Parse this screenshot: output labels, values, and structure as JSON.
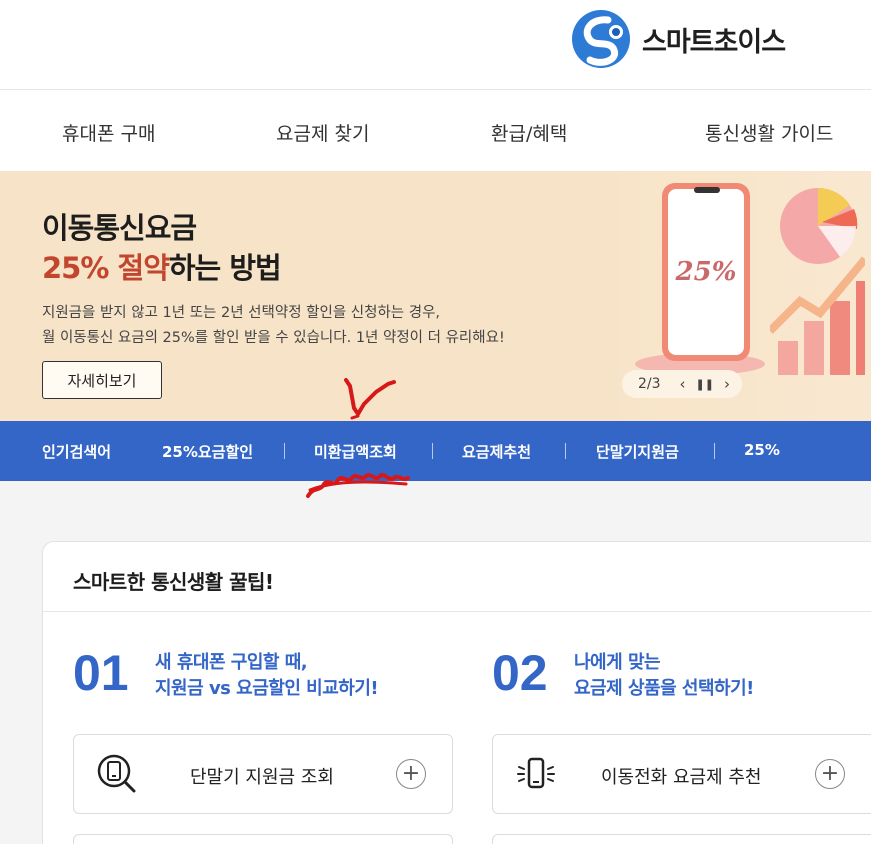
{
  "brand": {
    "name": "스마트초이스",
    "logo_colors": [
      "#2e7bd6",
      "#1a5fb8"
    ]
  },
  "gnb": {
    "items": [
      {
        "label": "휴대폰 구매"
      },
      {
        "label": "요금제 찾기"
      },
      {
        "label": "환급/혜택"
      },
      {
        "label": "통신생활 가이드"
      }
    ]
  },
  "banner": {
    "title_line1": "이동통신요금",
    "title_highlight": "25% 절약",
    "title_rest": "하는 방법",
    "desc_line1": "지원금을 받지 않고 1년 또는 2년 선택약정 할인을 신청하는 경우,",
    "desc_line2": "월 이동통신 요금의 25%를 할인 받을 수 있습니다. 1년 약정이 더 유리해요!",
    "more_button": "자세히보기",
    "phone_screen_text": "25%",
    "pager": "2/3",
    "prev_icon": "chevron-left-icon",
    "pause_icon": "pause-icon",
    "next_icon": "chevron-right-icon",
    "bg_color": "#f7e4c8",
    "highlight_color": "#c2452d"
  },
  "hot_keywords": {
    "title": "인기검색어",
    "items": [
      {
        "label": "25%요금할인"
      },
      {
        "label": "미환급액조회"
      },
      {
        "label": "요금제추천"
      },
      {
        "label": "단말기지원금"
      },
      {
        "label": "25%"
      }
    ],
    "bg_color": "#3466c8"
  },
  "tips": {
    "title": "스마트한 통신생활 꿀팁!",
    "items": [
      {
        "number": "01",
        "line1": "새 휴대폰 구입할 때,",
        "line2": "지원금 vs 요금할인 비교하기!",
        "action_label": "단말기 지원금 조회",
        "action_icon": "phone-search-icon"
      },
      {
        "number": "02",
        "line1": "나에게 맞는",
        "line2": "요금제 상품을 선택하기!",
        "action_label": "이동전화 요금제 추천",
        "action_icon": "phone-sparkle-icon"
      }
    ],
    "accent_color": "#3466c8"
  },
  "annotation": {
    "color": "#d81818"
  }
}
